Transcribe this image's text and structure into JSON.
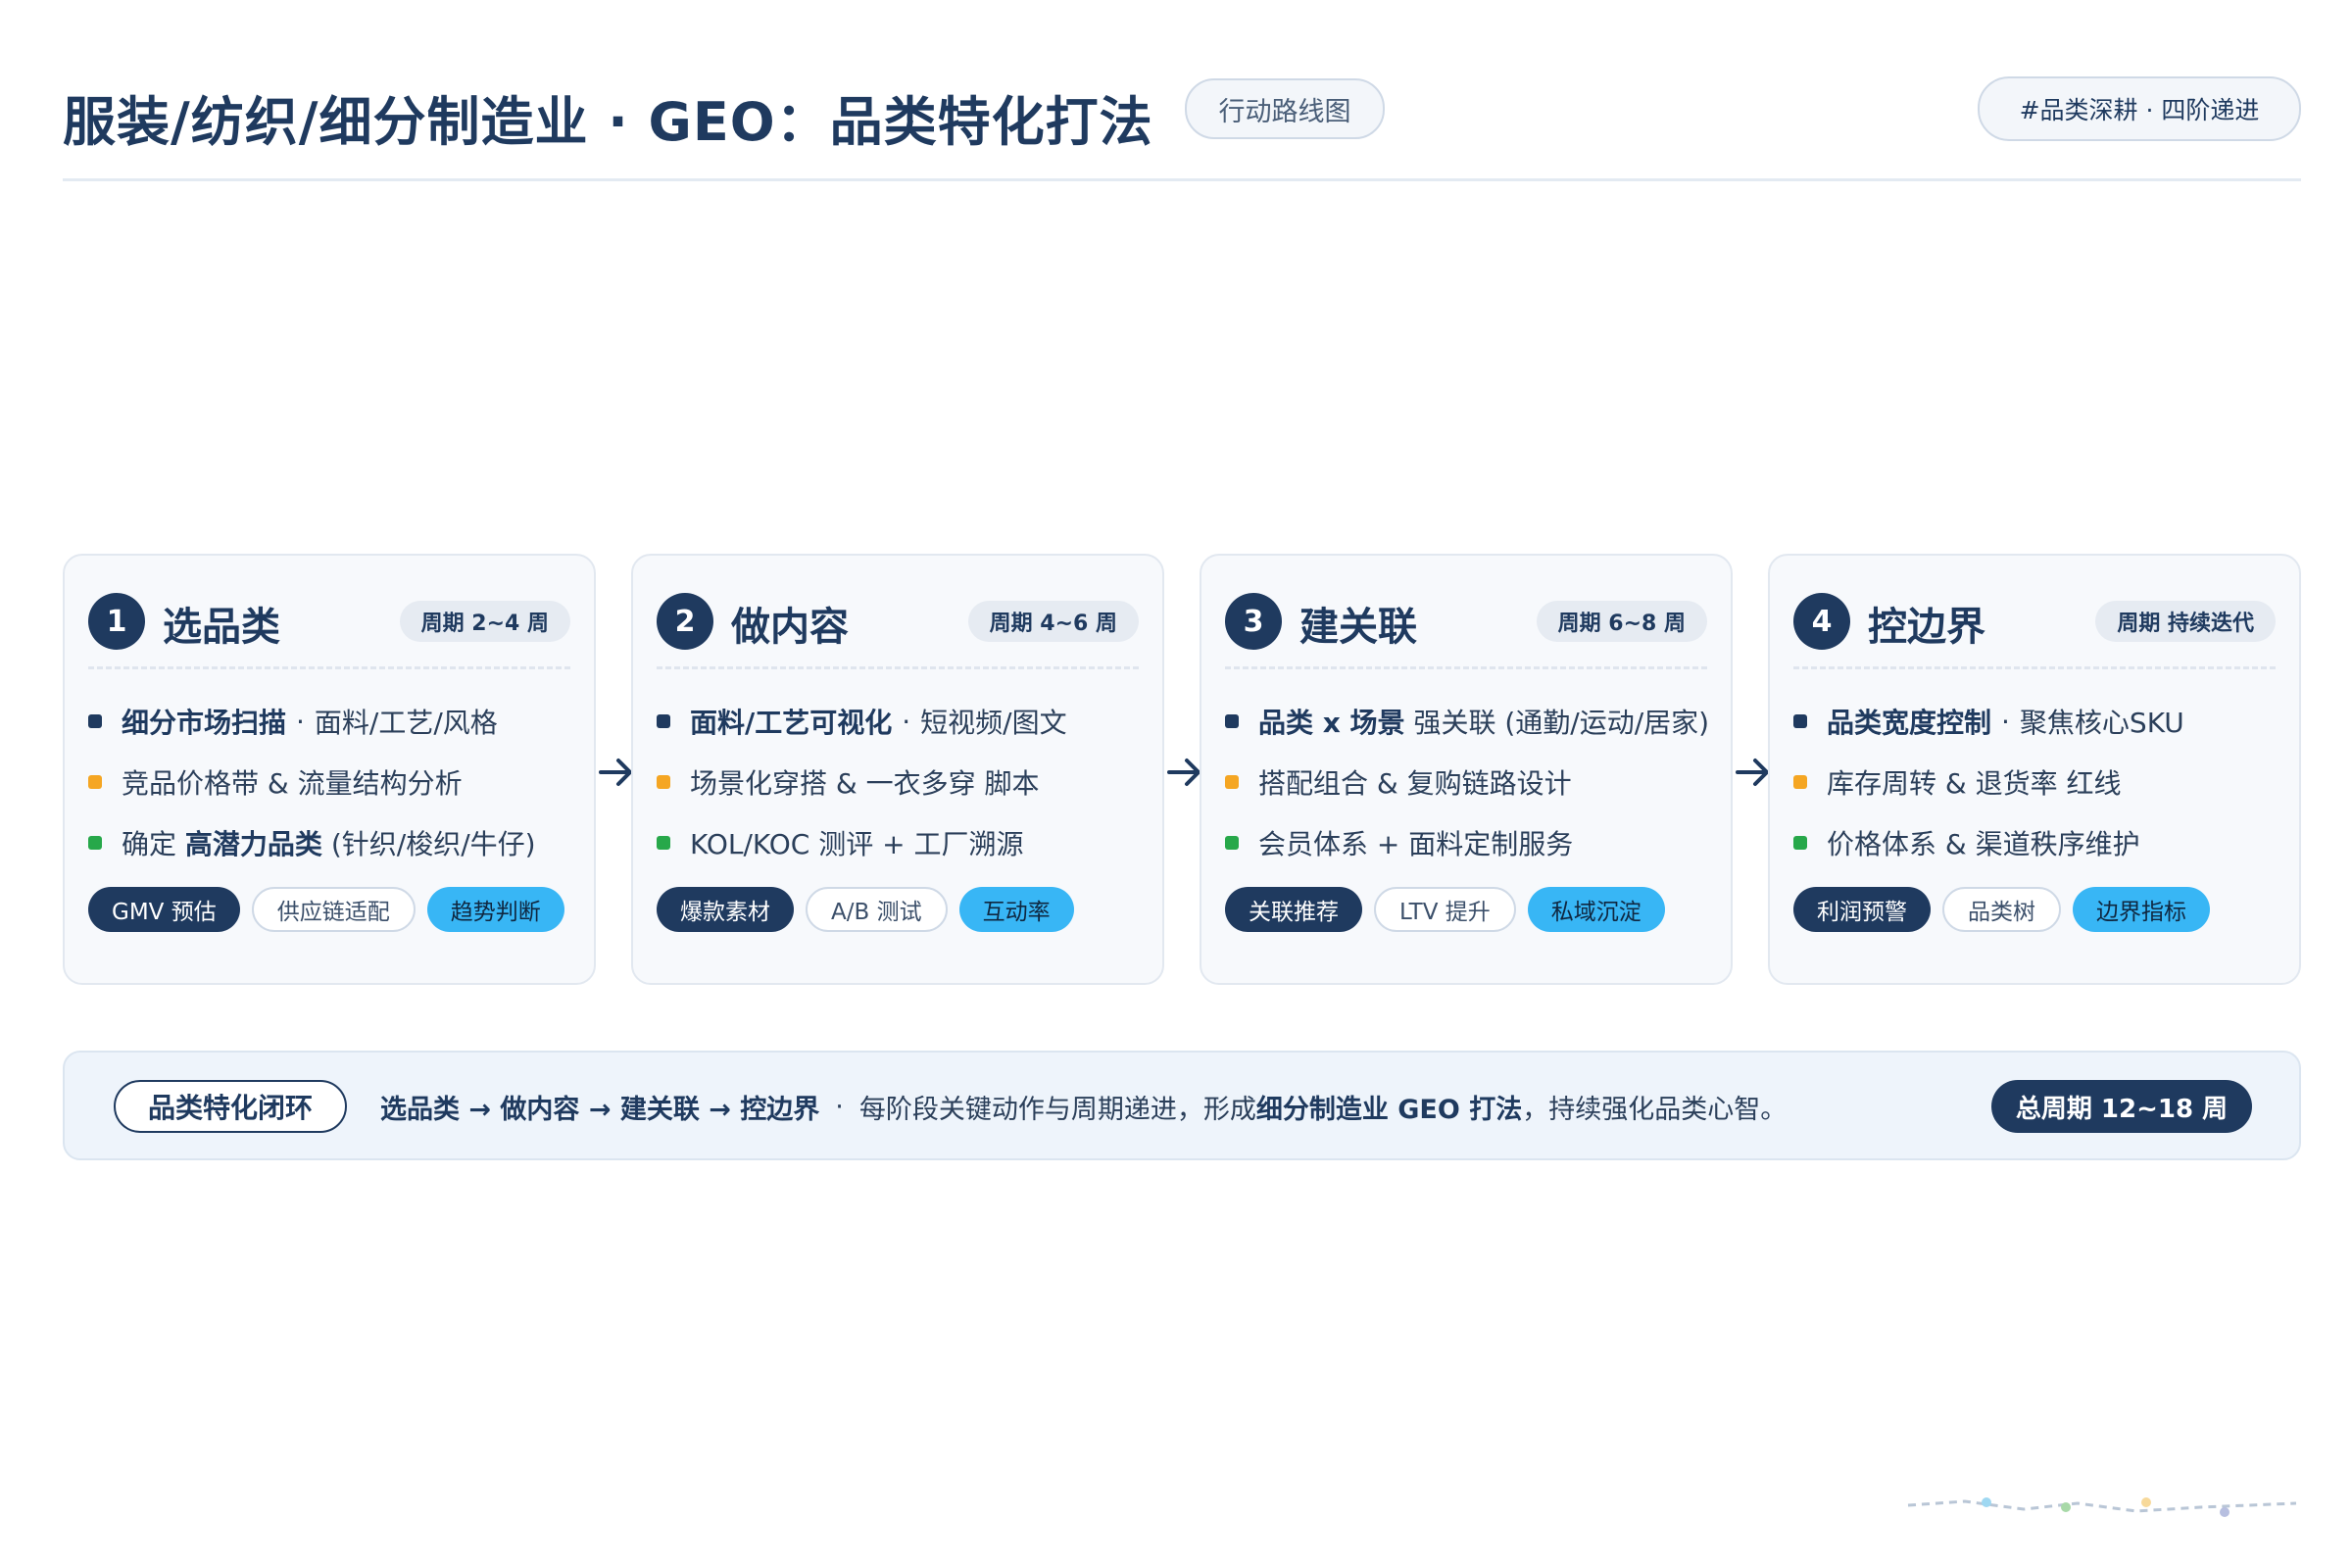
{
  "header": {
    "title": "服装/纺织/细分制造业 · GEO：品类特化打法",
    "title_pill": "行动路线图",
    "tag": "#品类深耕 · 四阶递进"
  },
  "colors": {
    "primary": "#1f3a5f",
    "accent_blue": "#38b6f5",
    "bullet_1": "#1f3a5f",
    "bullet_2": "#f5a623",
    "bullet_3": "#27a84a"
  },
  "stages": [
    {
      "num": "1",
      "title": "选品类",
      "period": "周期 2~4 周",
      "bullets": [
        {
          "bold": "细分市场扫描",
          "sep": "·",
          "text": "面料/工艺/风格"
        },
        {
          "text": "竞品价格带 & 流量结构分析"
        },
        {
          "pre": "确定",
          "bold": "高潜力品类",
          "text": "(针织/梭织/牛仔)"
        }
      ],
      "chips": [
        "GMV 预估",
        "供应链适配",
        "趋势判断"
      ]
    },
    {
      "num": "2",
      "title": "做内容",
      "period": "周期 4~6 周",
      "bullets": [
        {
          "bold": "面料/工艺可视化",
          "sep": "·",
          "text": "短视频/图文"
        },
        {
          "text": "场景化穿搭 & 一衣多穿 脚本"
        },
        {
          "text": "KOL/KOC 测评 + 工厂溯源"
        }
      ],
      "chips": [
        "爆款素材",
        "A/B 测试",
        "互动率"
      ]
    },
    {
      "num": "3",
      "title": "建关联",
      "period": "周期 6~8 周",
      "bullets": [
        {
          "bold": "品类 x 场景",
          "text": "强关联 (通勤/运动/居家)"
        },
        {
          "text": "搭配组合 & 复购链路设计"
        },
        {
          "text": "会员体系 + 面料定制服务"
        }
      ],
      "chips": [
        "关联推荐",
        "LTV 提升",
        "私域沉淀"
      ]
    },
    {
      "num": "4",
      "title": "控边界",
      "period": "周期 持续迭代",
      "bullets": [
        {
          "bold": "品类宽度控制",
          "sep": "·",
          "text": "聚焦核心SKU"
        },
        {
          "text": "库存周转 & 退货率 红线"
        },
        {
          "text": "价格体系 & 渠道秩序维护"
        }
      ],
      "chips": [
        "利润预警",
        "品类树",
        "边界指标"
      ]
    }
  ],
  "footer": {
    "loop_label": "品类特化闭环",
    "flow": "选品类 → 做内容 → 建关联 → 控边界",
    "sep": "·",
    "desc_pre": "每阶段关键动作与周期递进，形成",
    "desc_bold": "细分制造业 GEO 打法",
    "desc_post": "，持续强化品类心智。",
    "total": "总周期 12~18 周"
  }
}
